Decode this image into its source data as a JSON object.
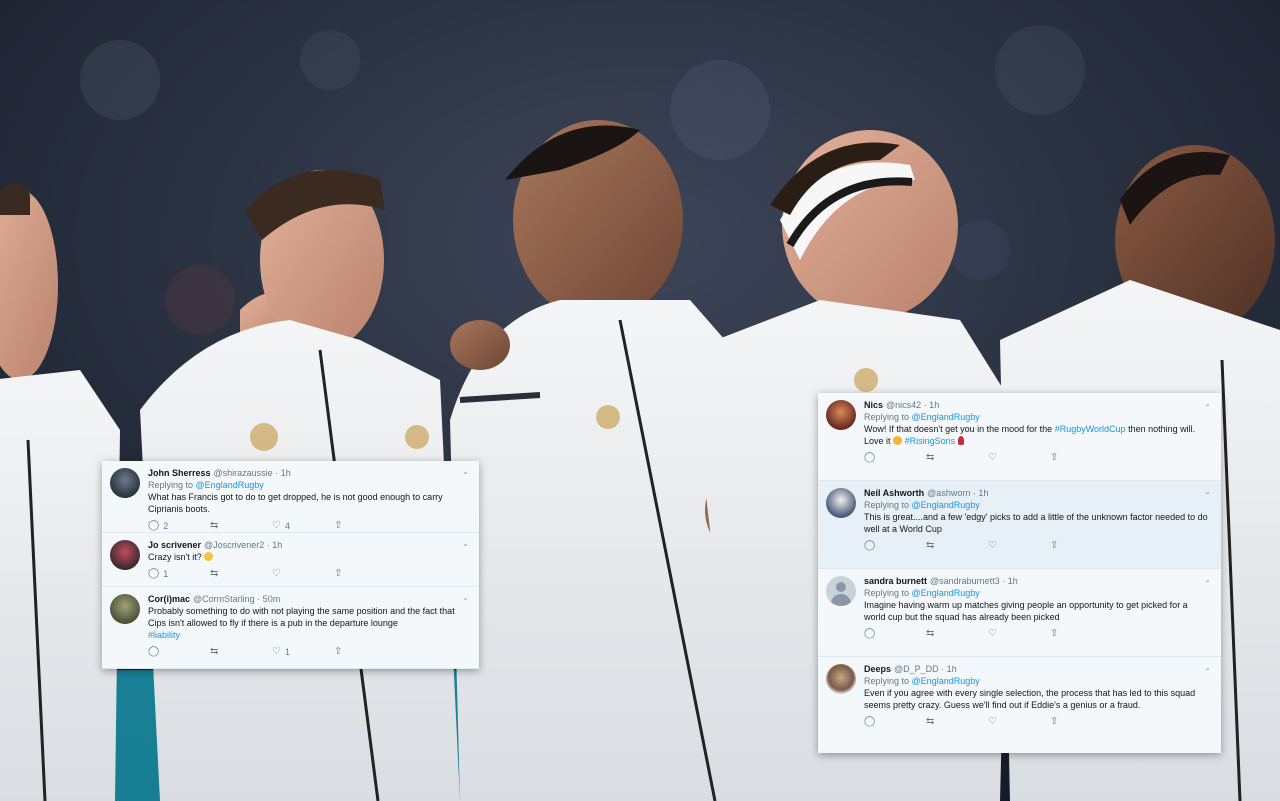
{
  "left_tweets": [
    {
      "name": "John Sherress",
      "handle": "@shirazaussie",
      "time": "· 1h",
      "text": "What has Francis got to do to get dropped, he is not good enough to carry Ciprianis boots.",
      "reply_count": "2",
      "like_count": "4"
    },
    {
      "name": "Jo scrivener",
      "handle": "@Joscrivener2",
      "time": "· 1h",
      "text": "Crazy isn't it?",
      "reply_count": "1"
    },
    {
      "name": "Cor(i)mac",
      "handle": "@CormStarling",
      "time": "· 50m",
      "text": "Probably something to do with not playing the same position and the fact that Cips isn't allowed to fly if there is a pub in the departure lounge",
      "hashtag": "#liability",
      "like_count": "1"
    }
  ],
  "replying_to": "Replying to",
  "mention": "@EnglandRugby",
  "right_tweets": [
    {
      "name": "Nics",
      "handle": "@nics42",
      "time": "· 1h",
      "text_before": "Wow! If that doesn't get you in the mood for the",
      "hashtag": "#RugbyWorldCup",
      "text_after": "then nothing will. Love it",
      "hashtag2": "#RisingSons"
    },
    {
      "name": "Neil Ashworth",
      "handle": "@ashworn",
      "time": "· 1h",
      "text": "This is great....and a few 'edgy' picks to add a little of the unknown factor needed to do well at a World Cup"
    },
    {
      "name": "sandra burnett",
      "handle": "@sandraburnett3",
      "time": "· 1h",
      "text": "Imagine having warm up matches giving people an opportunity to get picked for a world cup but the squad has already been picked"
    },
    {
      "name": "Deeps",
      "handle": "@D_P_DD",
      "time": "· 1h",
      "text": "Even if you agree with every single selection, the process that has led to this squad seems pretty crazy. Guess we'll find out if Eddie's a genius or a fraud."
    }
  ],
  "icons": {
    "reply": "reply-icon",
    "retweet": "retweet-icon",
    "like": "heart-icon",
    "share": "share-icon",
    "more": "chevron-down-icon"
  },
  "colors": {
    "link": "#1b95e0",
    "card_bg": "#f5f8fa",
    "jersey": "#eef0f2"
  }
}
